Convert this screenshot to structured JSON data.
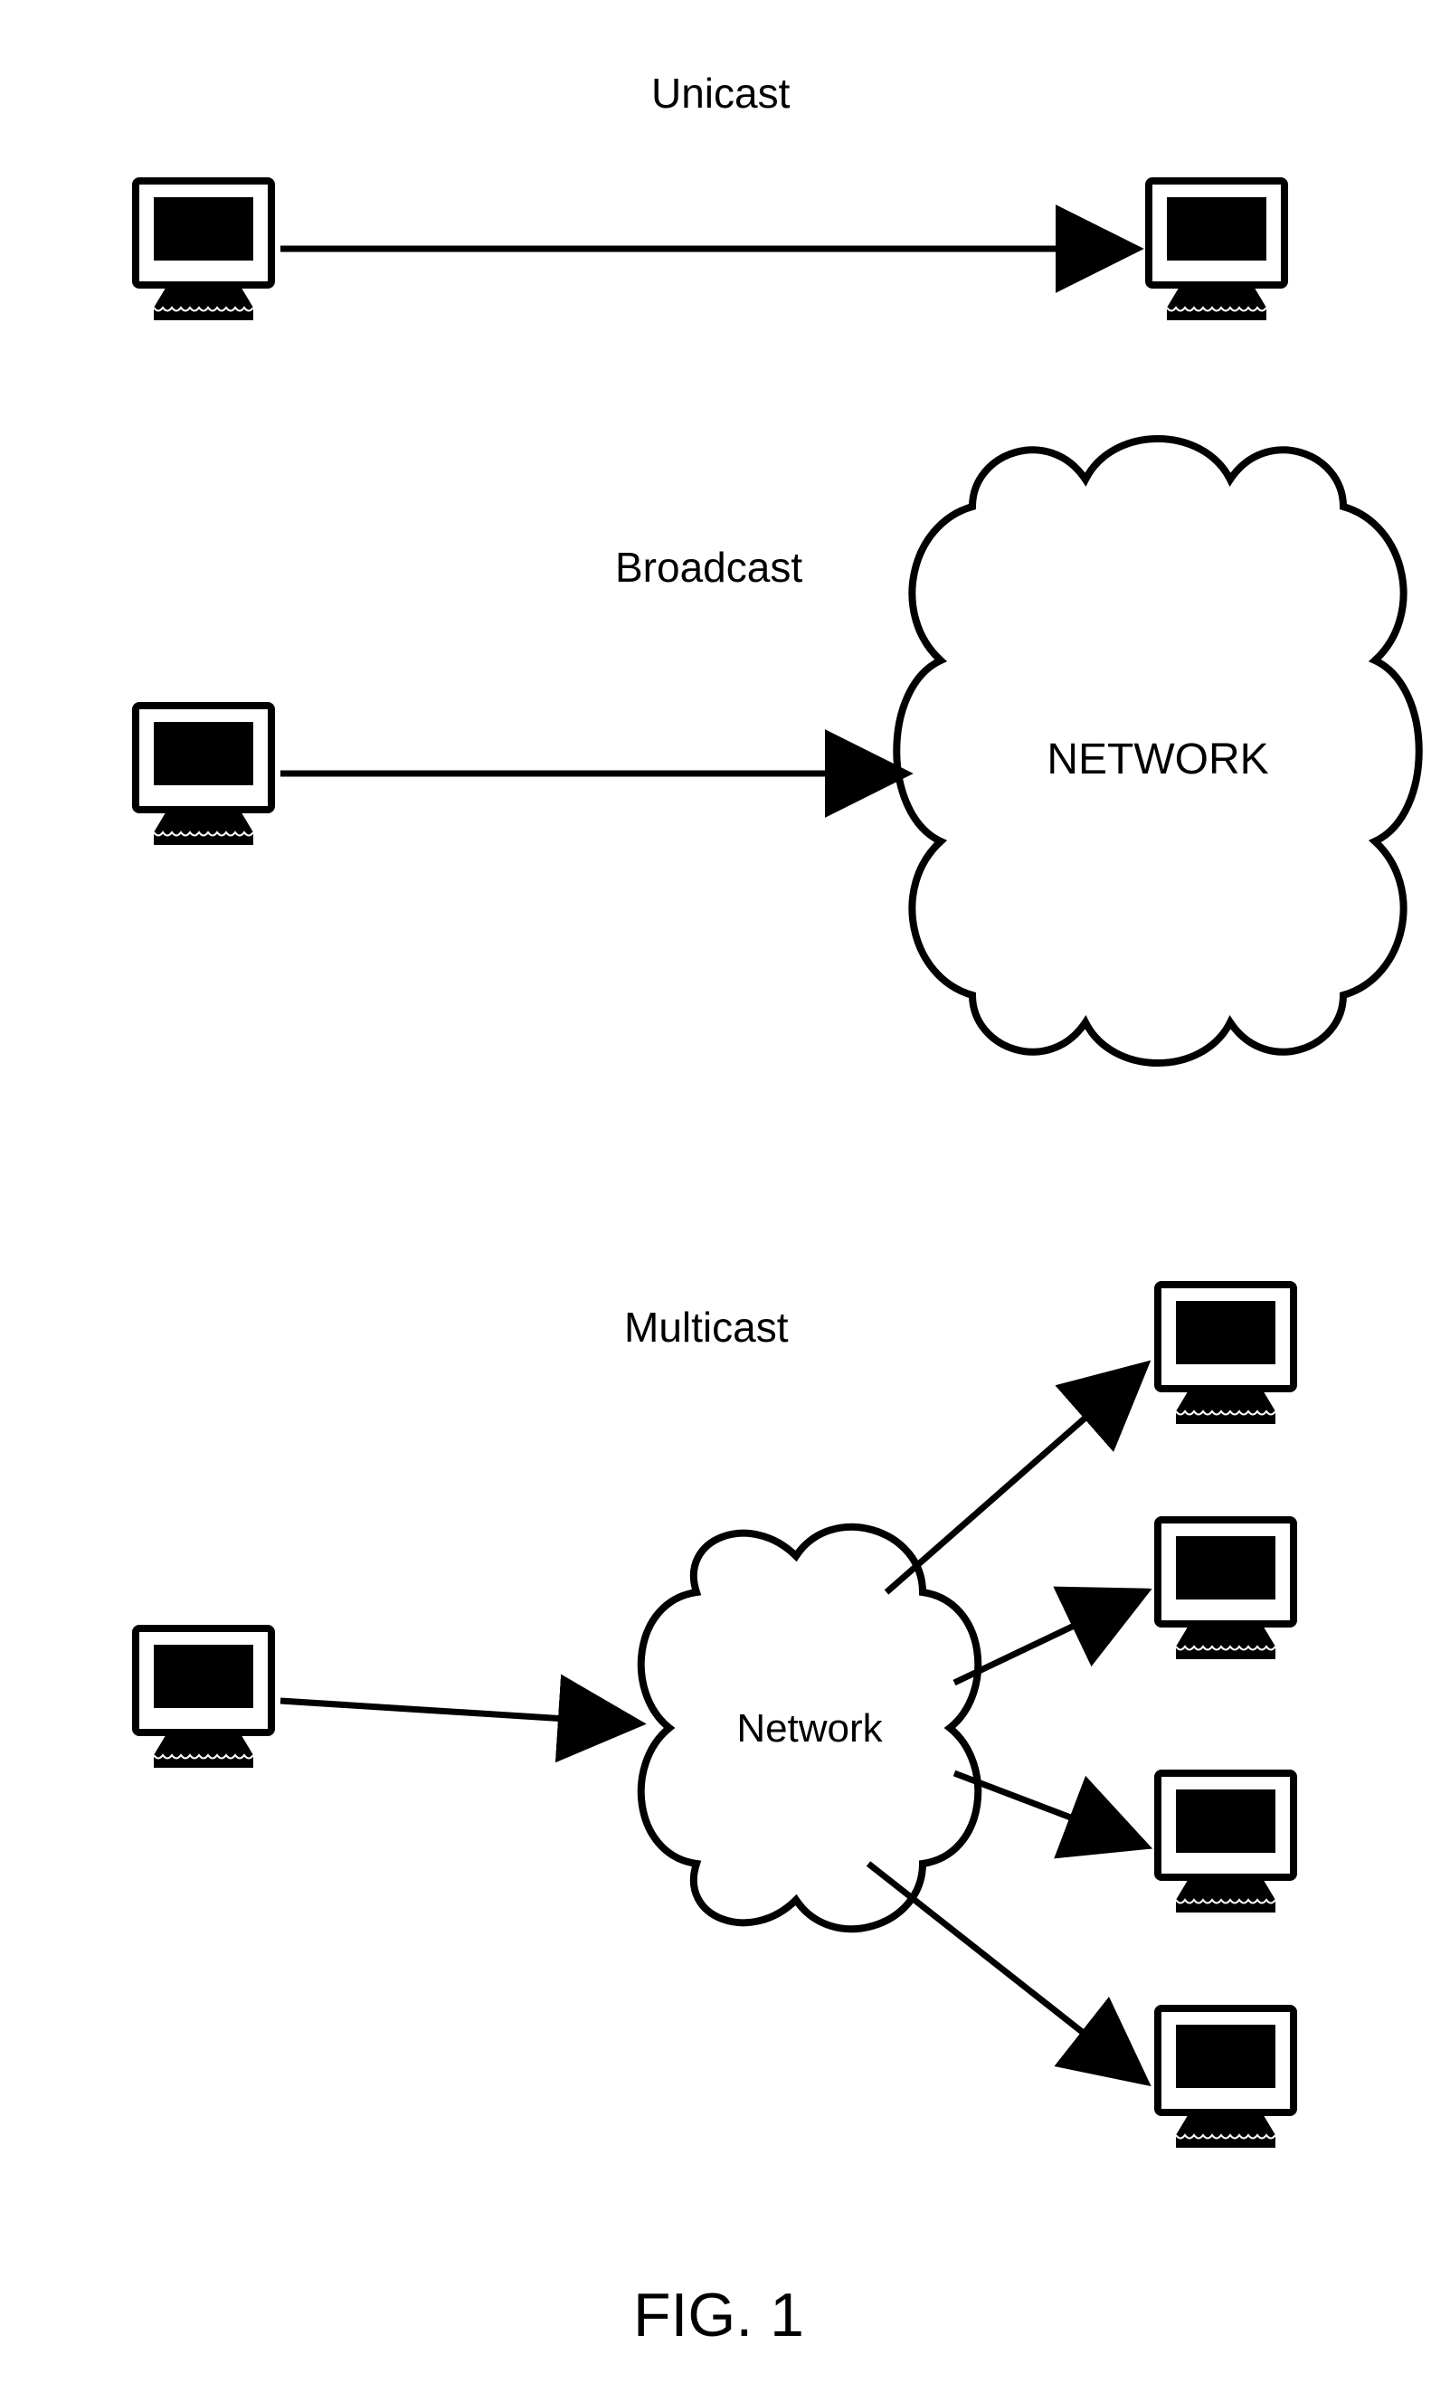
{
  "title_unicast": "Unicast",
  "title_broadcast": "Broadcast",
  "title_multicast": "Multicast",
  "cloud_broadcast_label": "NETWORK",
  "cloud_multicast_label": "Network",
  "figure_caption": "FIG. 1"
}
